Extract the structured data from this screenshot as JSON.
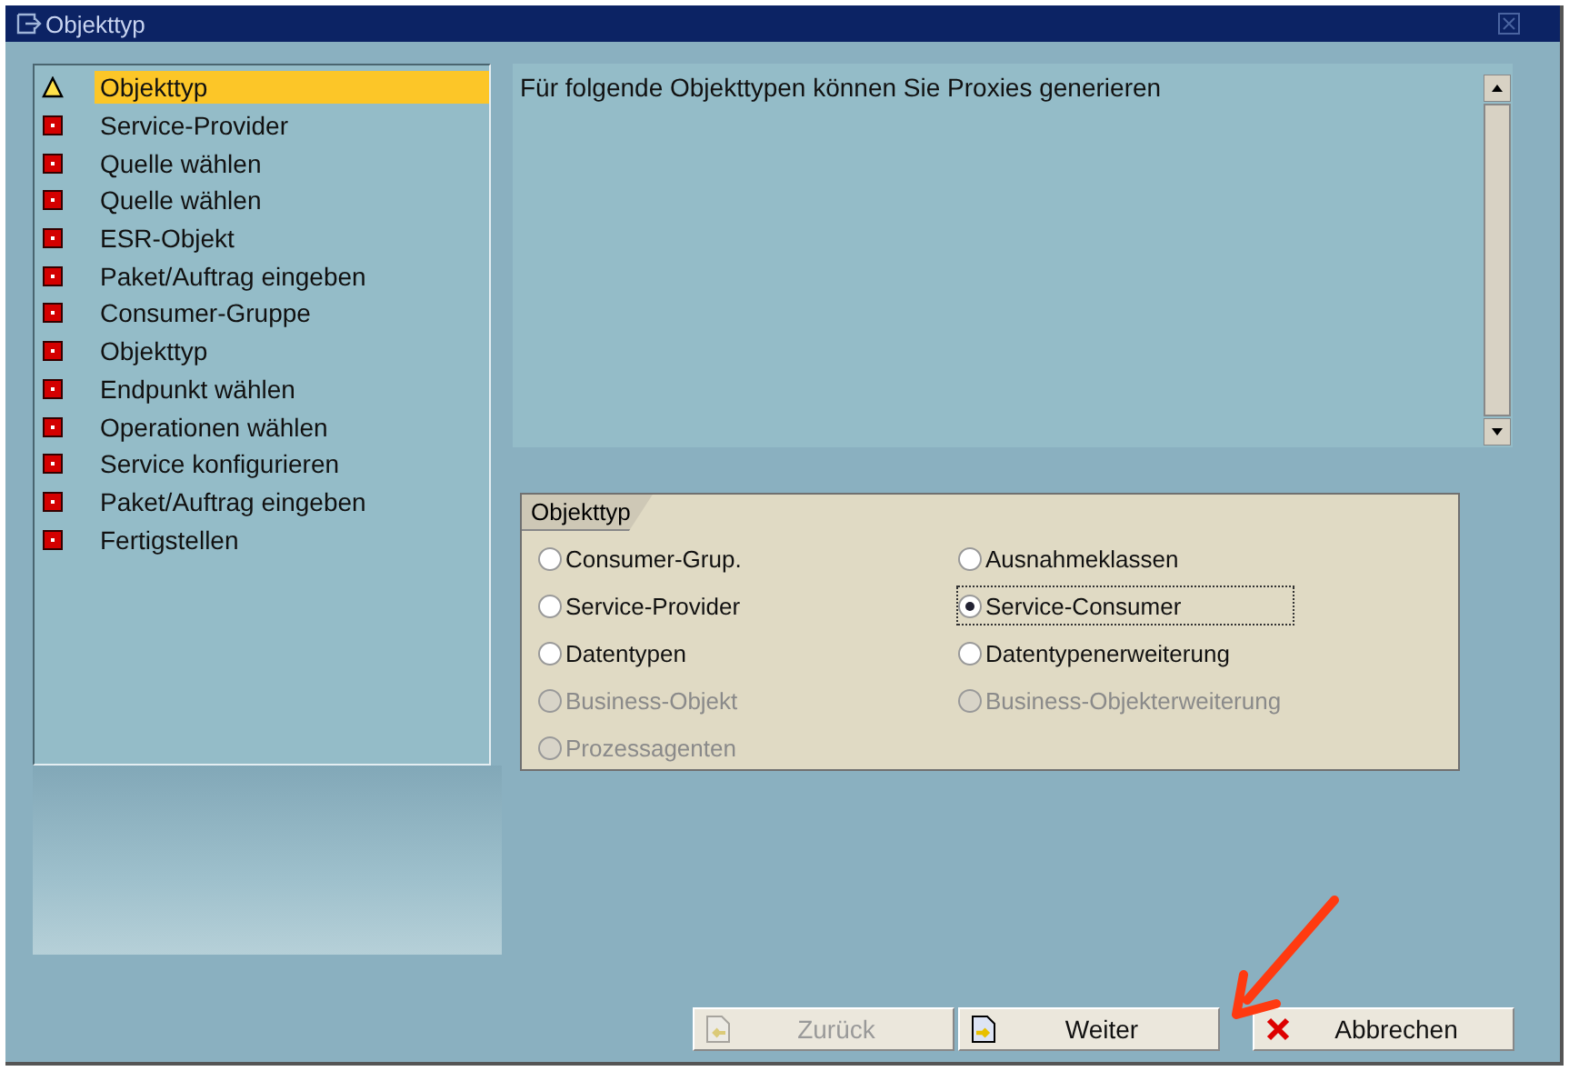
{
  "window": {
    "title": "Objekttyp"
  },
  "steps": [
    {
      "label": "Objekttyp",
      "kind": "warning",
      "selected": true
    },
    {
      "label": "Service-Provider",
      "kind": "error",
      "selected": false
    },
    {
      "label": "Quelle wählen",
      "kind": "error",
      "selected": false
    },
    {
      "label": "Quelle wählen",
      "kind": "error",
      "selected": false
    },
    {
      "label": "ESR-Objekt",
      "kind": "error",
      "selected": false
    },
    {
      "label": "Paket/Auftrag eingeben",
      "kind": "error",
      "selected": false
    },
    {
      "label": "Consumer-Gruppe",
      "kind": "error",
      "selected": false
    },
    {
      "label": "Objekttyp",
      "kind": "error",
      "selected": false
    },
    {
      "label": "Endpunkt wählen",
      "kind": "error",
      "selected": false
    },
    {
      "label": "Operationen wählen",
      "kind": "error",
      "selected": false
    },
    {
      "label": "Service konfigurieren",
      "kind": "error",
      "selected": false
    },
    {
      "label": "Paket/Auftrag eingeben",
      "kind": "error",
      "selected": false
    },
    {
      "label": "Fertigstellen",
      "kind": "error",
      "selected": false
    }
  ],
  "info_text": "Für folgende Objekttypen können Sie Proxies generieren",
  "group": {
    "title": "Objekttyp",
    "options": [
      {
        "label": "Consumer-Grup.",
        "selected": false,
        "disabled": false
      },
      {
        "label": "Ausnahmeklassen",
        "selected": false,
        "disabled": false
      },
      {
        "label": "Service-Provider",
        "selected": false,
        "disabled": false
      },
      {
        "label": "Service-Consumer",
        "selected": true,
        "disabled": false
      },
      {
        "label": "Datentypen",
        "selected": false,
        "disabled": false
      },
      {
        "label": "Datentypenerweiterung",
        "selected": false,
        "disabled": false
      },
      {
        "label": "Business-Objekt",
        "selected": false,
        "disabled": true
      },
      {
        "label": "Business-Objekterweiterung",
        "selected": false,
        "disabled": true
      },
      {
        "label": "Prozessagenten",
        "selected": false,
        "disabled": true
      }
    ]
  },
  "buttons": [
    {
      "label": "Zurück",
      "kind": "back",
      "disabled": true
    },
    {
      "label": "Weiter",
      "kind": "next",
      "disabled": false
    },
    {
      "label": "Abbrechen",
      "kind": "cancel",
      "disabled": false
    }
  ]
}
